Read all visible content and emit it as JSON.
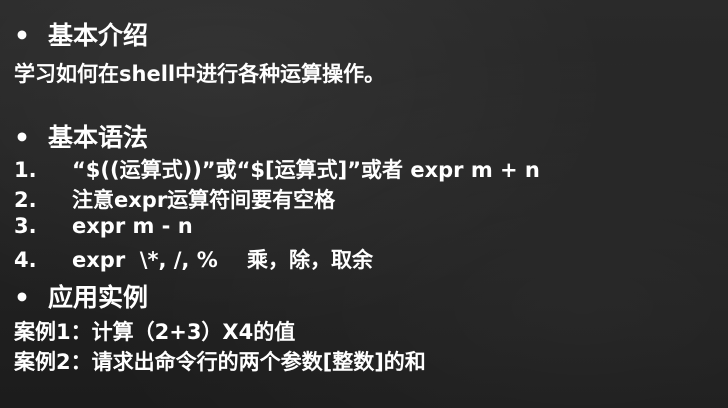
{
  "sections": {
    "intro": {
      "bullet": "•",
      "title": "基本介绍",
      "body": "学习如何在shell中进行各种运算操作。"
    },
    "syntax": {
      "bullet": "•",
      "title": "基本语法",
      "items": [
        {
          "num": "1.",
          "text": "“$((运算式))”或“$[运算式]”或者 expr m + n"
        },
        {
          "num": "2.",
          "text": "注意expr运算符间要有空格"
        },
        {
          "num": "3.",
          "text": "expr m - n"
        },
        {
          "num": "4.",
          "text": "expr  \\*, /, %    乘，除，取余"
        }
      ]
    },
    "examples": {
      "bullet": "•",
      "title": "应用实例",
      "items": [
        "案例1：计算（2+3）X4的值",
        "案例2：请求出命令行的两个参数[整数]的和"
      ]
    }
  }
}
